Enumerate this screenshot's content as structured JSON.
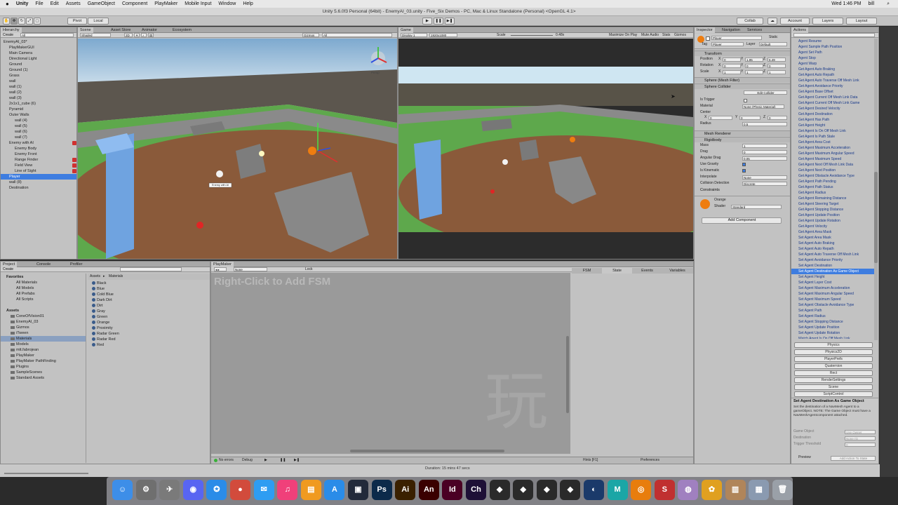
{
  "menubar": {
    "apple": "",
    "items": [
      "Unity",
      "File",
      "Edit",
      "Assets",
      "GameObject",
      "Component",
      "PlayMaker",
      "Mobile Input",
      "Window",
      "Help"
    ],
    "clock": "Wed 1:46 PM",
    "user": "bill"
  },
  "window_title": "Unity 5.6.0f3 Personal (64bit) - EnemyAI_03.unity - Five_Six Demos - PC, Mac & Linux Standalone (Personal) <OpenGL 4.1>",
  "toolbar": {
    "pivot": "Pivot",
    "local": "Local",
    "collab": "Collab",
    "account": "Account",
    "layers": "Layers",
    "layout": "Layout"
  },
  "hierarchy": {
    "tab": "Hierarchy",
    "create": "Create",
    "search_placeholder": "All",
    "items": [
      {
        "label": "EnemyAI_03*",
        "indent": 0,
        "selected": false,
        "red": false
      },
      {
        "label": "PlayMakerGUI",
        "indent": 1,
        "selected": false,
        "red": false
      },
      {
        "label": "Main Camera",
        "indent": 1,
        "selected": false,
        "red": false
      },
      {
        "label": "Directional Light",
        "indent": 1,
        "selected": false,
        "red": false
      },
      {
        "label": "Ground",
        "indent": 1,
        "selected": false,
        "red": false
      },
      {
        "label": "Ground (1)",
        "indent": 1,
        "selected": false,
        "red": false
      },
      {
        "label": "Grass",
        "indent": 1,
        "selected": false,
        "red": false
      },
      {
        "label": "wall",
        "indent": 1,
        "selected": false,
        "red": false
      },
      {
        "label": "wall (1)",
        "indent": 1,
        "selected": false,
        "red": false
      },
      {
        "label": "wall (2)",
        "indent": 1,
        "selected": false,
        "red": false
      },
      {
        "label": "wall (3)",
        "indent": 1,
        "selected": false,
        "red": false
      },
      {
        "label": "2x1x1_cube (6)",
        "indent": 1,
        "selected": false,
        "red": false
      },
      {
        "label": "Pyramid",
        "indent": 1,
        "selected": false,
        "red": false
      },
      {
        "label": "Outer Walls",
        "indent": 1,
        "selected": false,
        "red": false
      },
      {
        "label": "wall (4)",
        "indent": 2,
        "selected": false,
        "red": false
      },
      {
        "label": "wall (5)",
        "indent": 2,
        "selected": false,
        "red": false
      },
      {
        "label": "wall (6)",
        "indent": 2,
        "selected": false,
        "red": false
      },
      {
        "label": "wall (7)",
        "indent": 2,
        "selected": false,
        "red": false
      },
      {
        "label": "Enemy with AI",
        "indent": 1,
        "selected": false,
        "red": true
      },
      {
        "label": "Enemy Body",
        "indent": 2,
        "selected": false,
        "red": false
      },
      {
        "label": "Enemy Front",
        "indent": 2,
        "selected": false,
        "red": false
      },
      {
        "label": "Range Finder",
        "indent": 2,
        "selected": false,
        "red": true
      },
      {
        "label": "Field View",
        "indent": 2,
        "selected": false,
        "red": true
      },
      {
        "label": "Line of Sight",
        "indent": 2,
        "selected": false,
        "red": true
      },
      {
        "label": "Player",
        "indent": 1,
        "selected": true,
        "red": false
      },
      {
        "label": "wall (8)",
        "indent": 1,
        "selected": false,
        "red": false
      },
      {
        "label": "Destination",
        "indent": 1,
        "selected": false,
        "red": false
      }
    ]
  },
  "scene": {
    "tabs": [
      "Scene",
      "Asset Store",
      "Animator",
      "Ecosystem"
    ],
    "shading": "Shaded",
    "mode2d": "2D",
    "gizmos": "Gizmos",
    "search": "All",
    "persp": "Persp",
    "enemy_label": "Enemy with AI"
  },
  "game": {
    "tab": "Game",
    "display": "Display 1",
    "resolution": "1920x1080",
    "scale_label": "Scale",
    "scale_value": "0.48x",
    "maximize": "Maximize On Play",
    "mute": "Mute Audio",
    "stats": "Stats",
    "gizmos": "Gizmos"
  },
  "inspector": {
    "tabs": [
      "Inspector",
      "Navigation",
      "Services"
    ],
    "object_name": "Player",
    "static": "Static",
    "tag_label": "Tag",
    "tag_value": "Player",
    "layer_label": "Layer",
    "layer_value": "Default",
    "transform": {
      "title": "Transform",
      "rows": [
        {
          "label": "Position",
          "x": "0",
          "y": "1.95",
          "z": "6.49"
        },
        {
          "label": "Rotation",
          "x": "0",
          "y": "0",
          "z": "0"
        },
        {
          "label": "Scale",
          "x": "1",
          "y": "1",
          "z": "1"
        }
      ]
    },
    "mesh_filter": "Sphere (Mesh Filter)",
    "sphere_collider": {
      "title": "Sphere Collider",
      "edit_collider": "Edit Collider",
      "is_trigger": "Is Trigger",
      "material_label": "Material",
      "material_value": "None (Physic Material)",
      "center_label": "Center",
      "center_x": "0",
      "center_y": "0",
      "center_z": "0",
      "radius_label": "Radius",
      "radius_value": "0.5"
    },
    "mesh_renderer": "Mesh Renderer",
    "rigidbody": {
      "title": "Rigidbody",
      "fields": [
        {
          "label": "Mass",
          "value": "1"
        },
        {
          "label": "Drag",
          "value": "0"
        },
        {
          "label": "Angular Drag",
          "value": "0.05"
        },
        {
          "label": "Use Gravity",
          "value": ""
        },
        {
          "label": "Is Kinematic",
          "value": ""
        },
        {
          "label": "Interpolate",
          "value": "None"
        },
        {
          "label": "Collision Detection",
          "value": "Discrete"
        }
      ],
      "constraints": "Constraints"
    },
    "material": {
      "name": "Orange",
      "shader_label": "Shader",
      "shader_value": "Standard"
    },
    "add_component": "Add Component"
  },
  "actions": {
    "tab": "Actions",
    "items": [
      "Agent Resume",
      "Agent Sample Path Position",
      "Agent Set Path",
      "Agent Stop",
      "Agent Warp",
      "Get Agent Auto Braking",
      "Get Agent Auto Repath",
      "Get Agent Auto Traverse Off Mesh Link",
      "Get Agent Avoidance Priority",
      "Get Agent Base Offset",
      "Get Agent Current Off Mesh Link Data",
      "Get Agent Current Off Mesh Link Game",
      "Get Agent Desired Velocity",
      "Get Agent Destination",
      "Get Agent Has Path",
      "Get Agent Height",
      "Get Agent Is On Off Mesh Link",
      "Get Agent Is Path Stale",
      "Get Agent Area Cost",
      "Get Agent Maximum Acceleration",
      "Get Agent Maximum Angular Speed",
      "Get Agent Maximum Speed",
      "Get Agent Next Off Mesh Link Data",
      "Get Agent Next Position",
      "Get Agent Obstacle Avoidance Type",
      "Get Agent Path Pending",
      "Get Agent Path Status",
      "Get Agent Radius",
      "Get Agent Remaining Distance",
      "Get Agent Steering Target",
      "Get Agent Stopping Distance",
      "Get Agent Update Position",
      "Get Agent Update Rotation",
      "Get Agent Velocity",
      "Get Agent Area Mask",
      "Set Agent Area Mask",
      "Set Agent Auto Braking",
      "Set Agent Auto Repath",
      "Set Agent Auto Traverse Off Mesh Link",
      "Set Agent Avoidance Priority",
      "Set Agent Destination",
      "Set Agent Destination As Game Object",
      "Set Agent Height",
      "Set Agent Layer Cost",
      "Set Agent Maximum Acceleration",
      "Set Agent Maximum Angular Speed",
      "Set Agent Maximum Speed",
      "Set Agent Obstacle Avoidance Type",
      "Set Agent Path",
      "Set Agent Radius",
      "Set Agent Stopping Distance",
      "Set Agent Update Position",
      "Set Agent Update Rotation",
      "Watch Agent Is On Off Mesh Link"
    ],
    "selected_index": 41,
    "categories": [
      "Physics",
      "Physics2D",
      "PlayerPrefs",
      "Quaternion",
      "Rect",
      "RenderSettings",
      "Scene",
      "ScriptControl"
    ],
    "detail_title": "Set Agent Destination As Game Object",
    "detail_text": "Set the destination of a NavMesh Agent to a gameObject. NOTE: The Game Object must have a NavMeshAgentcomponent attached.",
    "params": [
      {
        "label": "Game Object",
        "value": "Use Owner"
      },
      {
        "label": "Destination",
        "value": "None (G"
      },
      {
        "label": "Trigger Threshold",
        "value": "0"
      }
    ],
    "preview": "Preview",
    "add_to_state": "Add Action To State"
  },
  "project": {
    "tabs": [
      "Project",
      "Console",
      "Profiler"
    ],
    "create": "Create",
    "favorites_title": "Favorites",
    "favorites": [
      "All Materials",
      "All Models",
      "All Prefabs",
      "All Scripts"
    ],
    "assets_title": "Assets",
    "assets_tree": [
      "ConeOfVision01",
      "EnemyAI_03",
      "Gizmos",
      "iTween",
      "Materials",
      "Models",
      "mtt.fabrojean",
      "PlayMaker",
      "PlayMaker PathFinding",
      "Plugins",
      "SampleScenes",
      "Standard Assets"
    ],
    "breadcrumb_root": "Assets",
    "breadcrumb_current": "Materials",
    "materials": [
      "Black",
      "Blue",
      "Cold Blue",
      "Dark Dirt",
      "Dirt",
      "Gray",
      "Green",
      "Orange",
      "Proximity",
      "Radar Green",
      "Radar Red",
      "Red"
    ]
  },
  "playmaker": {
    "tab": "PlayMaker",
    "fsm_select": "None",
    "lock": "Lock",
    "hint": "Right-Click to Add FSM",
    "watermark": "玩",
    "right_tabs": [
      "FSM",
      "State",
      "Events",
      "Variables"
    ],
    "no_errors": "No errors",
    "debug": "Debug",
    "hints": "Hints [F1]",
    "preferences": "Preferences"
  },
  "status": {
    "duration": "Duration: 15 mins 47 secs"
  },
  "dock_icons": [
    {
      "name": "finder-icon",
      "glyph": "☺",
      "color": "#3d8ee8"
    },
    {
      "name": "system-preferences-icon",
      "glyph": "⚙",
      "color": "#6f6f6f"
    },
    {
      "name": "launchpad-icon",
      "glyph": "✈",
      "color": "#7a7a7a"
    },
    {
      "name": "discord-icon",
      "glyph": "◉",
      "color": "#5865f2"
    },
    {
      "name": "safari-icon",
      "glyph": "✪",
      "color": "#2a8ce8"
    },
    {
      "name": "chrome-icon",
      "glyph": "●",
      "color": "#d24b3c"
    },
    {
      "name": "messages-icon",
      "glyph": "✉",
      "color": "#2e9df2"
    },
    {
      "name": "itunes-icon",
      "glyph": "♫",
      "color": "#f0407a"
    },
    {
      "name": "ibooks-icon",
      "glyph": "▤",
      "color": "#f09a20"
    },
    {
      "name": "app-store-icon",
      "glyph": "A",
      "color": "#2a8ce8"
    },
    {
      "name": "monodevelop-icon",
      "glyph": "▣",
      "color": "#222a3a"
    },
    {
      "name": "photoshop-icon",
      "glyph": "Ps",
      "color": "#0c2a4a"
    },
    {
      "name": "illustrator-icon",
      "glyph": "Ai",
      "color": "#3a2000"
    },
    {
      "name": "animate-icon",
      "glyph": "An",
      "color": "#3a0000"
    },
    {
      "name": "indesign-icon",
      "glyph": "Id",
      "color": "#4a0024"
    },
    {
      "name": "character-animator-icon",
      "glyph": "Ch",
      "color": "#1e1036"
    },
    {
      "name": "unity-icon-1",
      "glyph": "◆",
      "color": "#2a2a2a"
    },
    {
      "name": "unity-icon-2",
      "glyph": "◆",
      "color": "#2a2a2a"
    },
    {
      "name": "unity-icon-3",
      "glyph": "◆",
      "color": "#2a2a2a"
    },
    {
      "name": "unity-icon-4",
      "glyph": "◆",
      "color": "#2a2a2a"
    },
    {
      "name": "blender-like-icon",
      "glyph": "◐",
      "color": "#1b3a6a"
    },
    {
      "name": "maya-icon",
      "glyph": "M",
      "color": "#1aa6a6"
    },
    {
      "name": "blender-icon",
      "glyph": "◎",
      "color": "#e87d0d"
    },
    {
      "name": "substance-icon",
      "glyph": "S",
      "color": "#c03030"
    },
    {
      "name": "paint-icon",
      "glyph": "◍",
      "color": "#a080c0"
    },
    {
      "name": "photos-icon",
      "glyph": "✿",
      "color": "#e0a020"
    },
    {
      "name": "notes-icon",
      "glyph": "▥",
      "color": "#b0855a"
    },
    {
      "name": "downloads-icon",
      "glyph": "▦",
      "color": "#8a9ab0"
    },
    {
      "name": "trash-icon",
      "glyph": "🗑",
      "color": "#9aa0a8"
    }
  ],
  "colors": {
    "selection": "#3e7de0",
    "sky": "#8fb9dd",
    "grass": "#5ea84c",
    "dirt": "#8a5a3a",
    "wall": "#7f7f7f",
    "cube_blue": "#6fa3e0",
    "orange_ball": "#ee7d10",
    "red_ball": "#e02525"
  }
}
